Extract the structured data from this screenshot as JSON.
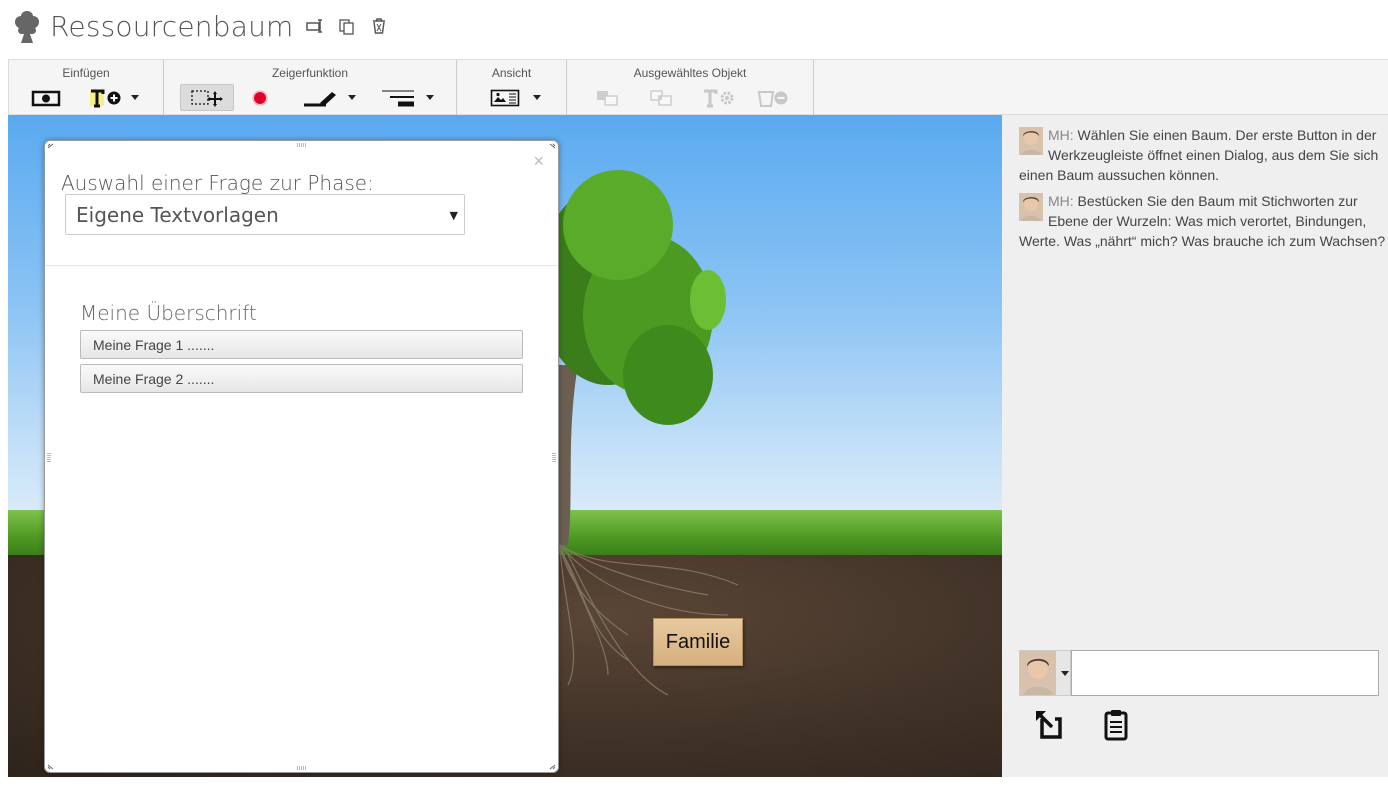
{
  "app": {
    "title": "Ressourcenbaum"
  },
  "toolbar": {
    "groups": [
      {
        "label": "Einfügen"
      },
      {
        "label": "Zeigerfunktion"
      },
      {
        "label": "Ansicht"
      },
      {
        "label": "Ausgewähltes Objekt"
      }
    ]
  },
  "canvas": {
    "note_label": "Familie"
  },
  "dialog": {
    "title": "Auswahl einer Frage zur Phase:",
    "select_value": "Eigene Textvorlagen",
    "close_glyph": "×",
    "heading": "Meine Überschrift",
    "questions": [
      "Meine Frage 1 .......",
      "Meine Frage 2 ......."
    ]
  },
  "chat": {
    "messages": [
      {
        "sender": "MH:",
        "text": " Wählen Sie einen Baum. Der erste Button in der Werkzeugleiste öffnet einen Dialog, aus dem Sie sich einen Baum aussuchen können."
      },
      {
        "sender": "MH:",
        "text": " Bestücken Sie den Baum mit Stichworten zur Ebene der Wurzeln: Was mich verortet, Bindungen, Werte. Was „nährt“ mich? Was brauche ich zum Wachsen?"
      }
    ]
  },
  "colors": {
    "sky": "#5aaaf0",
    "grass": "#4e9a24",
    "soil": "#3f3127",
    "note": "#d6b07e",
    "chat_bg": "#efefef",
    "record_red": "#e0002a"
  },
  "icons": [
    "tree-logo-icon",
    "rename-icon",
    "copy-icon",
    "trash-icon",
    "insert-image-icon",
    "insert-text-icon",
    "select-move-icon",
    "record-dot-icon",
    "pen-icon",
    "line-style-icon",
    "view-card-icon",
    "send-back-icon",
    "bring-front-icon",
    "text-settings-icon",
    "remove-icon",
    "export-icon",
    "clipboard-icon"
  ]
}
